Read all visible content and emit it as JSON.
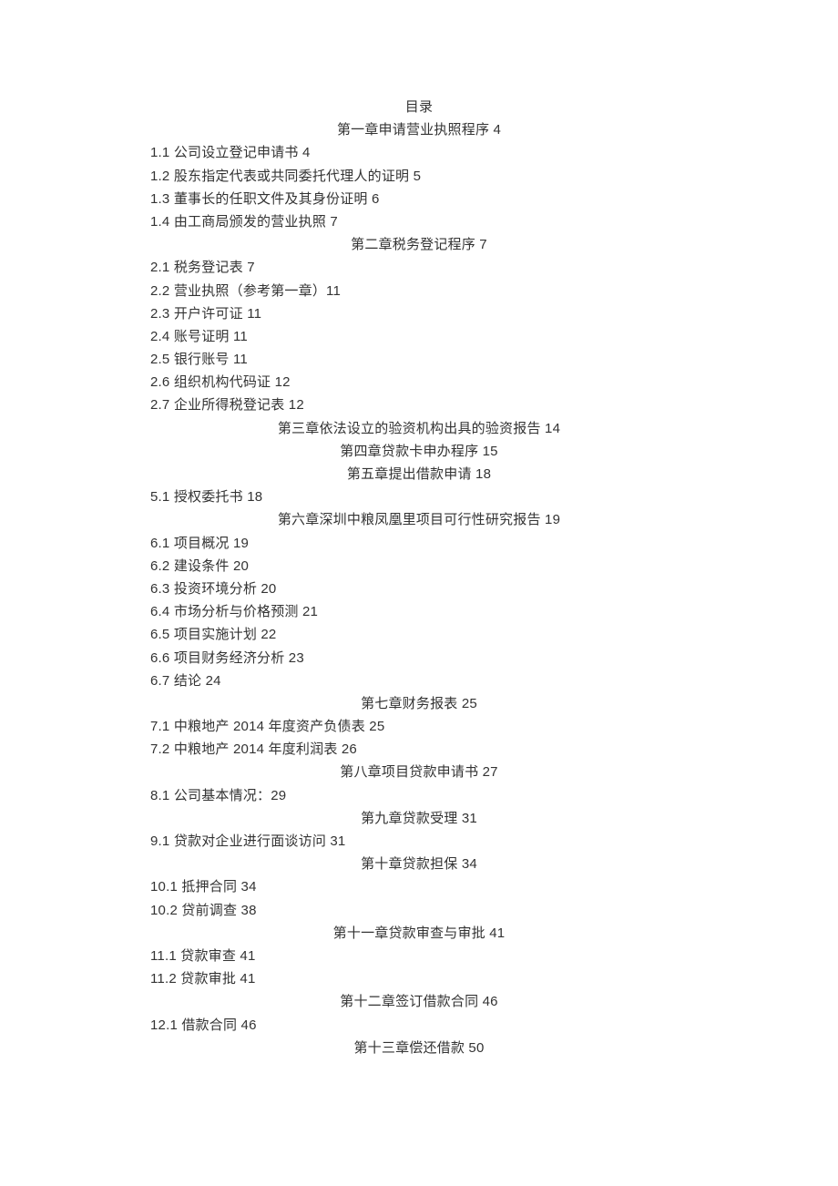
{
  "title": "目录",
  "items": [
    {
      "type": "chapter",
      "text": "第一章申请营业执照程序 4"
    },
    {
      "type": "entry",
      "text": "1.1 公司设立登记申请书 4"
    },
    {
      "type": "entry",
      "text": "1.2 股东指定代表或共同委托代理人的证明 5"
    },
    {
      "type": "entry",
      "text": "1.3 董事长的任职文件及其身份证明 6"
    },
    {
      "type": "entry",
      "text": "1.4 由工商局颁发的营业执照 7"
    },
    {
      "type": "chapter",
      "text": "第二章税务登记程序 7"
    },
    {
      "type": "entry",
      "text": "2.1 税务登记表 7"
    },
    {
      "type": "entry",
      "text": "2.2 营业执照（参考第一章）11"
    },
    {
      "type": "entry",
      "text": "2.3 开户许可证 11"
    },
    {
      "type": "entry",
      "text": "2.4 账号证明 11"
    },
    {
      "type": "entry",
      "text": "2.5 银行账号 11"
    },
    {
      "type": "entry",
      "text": "2.6 组织机构代码证 12"
    },
    {
      "type": "entry",
      "text": "2.7 企业所得税登记表 12"
    },
    {
      "type": "chapter",
      "text": "第三章依法设立的验资机构出具的验资报告 14"
    },
    {
      "type": "chapter",
      "text": "第四章贷款卡申办程序 15"
    },
    {
      "type": "chapter",
      "text": "第五章提出借款申请 18"
    },
    {
      "type": "entry",
      "text": "5.1 授权委托书 18"
    },
    {
      "type": "chapter",
      "text": "第六章深圳中粮凤凰里项目可行性研究报告 19"
    },
    {
      "type": "entry",
      "text": "6.1 项目概况 19"
    },
    {
      "type": "entry",
      "text": "6.2 建设条件 20"
    },
    {
      "type": "entry",
      "text": "6.3 投资环境分析 20"
    },
    {
      "type": "entry",
      "text": "6.4 市场分析与价格预测 21"
    },
    {
      "type": "entry",
      "text": "6.5 项目实施计划 22"
    },
    {
      "type": "entry",
      "text": "6.6 项目财务经济分析 23"
    },
    {
      "type": "entry",
      "text": "6.7 结论 24"
    },
    {
      "type": "chapter",
      "text": "第七章财务报表 25"
    },
    {
      "type": "entry",
      "text": "7.1 中粮地产 2014 年度资产负债表 25"
    },
    {
      "type": "entry",
      "text": "7.2 中粮地产 2014 年度利润表 26"
    },
    {
      "type": "chapter",
      "text": "第八章项目贷款申请书 27"
    },
    {
      "type": "entry",
      "text": "8.1 公司基本情况：29"
    },
    {
      "type": "chapter",
      "text": "第九章贷款受理 31"
    },
    {
      "type": "entry",
      "text": "9.1 贷款对企业进行面谈访问 31"
    },
    {
      "type": "chapter",
      "text": "第十章贷款担保 34"
    },
    {
      "type": "entry",
      "text": "10.1 抵押合同 34"
    },
    {
      "type": "entry",
      "text": "10.2 贷前调查 38"
    },
    {
      "type": "chapter",
      "text": "第十一章贷款审查与审批 41"
    },
    {
      "type": "entry",
      "text": "11.1 贷款审查 41"
    },
    {
      "type": "entry",
      "text": "11.2 贷款审批 41"
    },
    {
      "type": "chapter",
      "text": "第十二章签订借款合同 46"
    },
    {
      "type": "entry",
      "text": "12.1 借款合同 46"
    },
    {
      "type": "chapter",
      "text": "第十三章偿还借款 50"
    }
  ]
}
